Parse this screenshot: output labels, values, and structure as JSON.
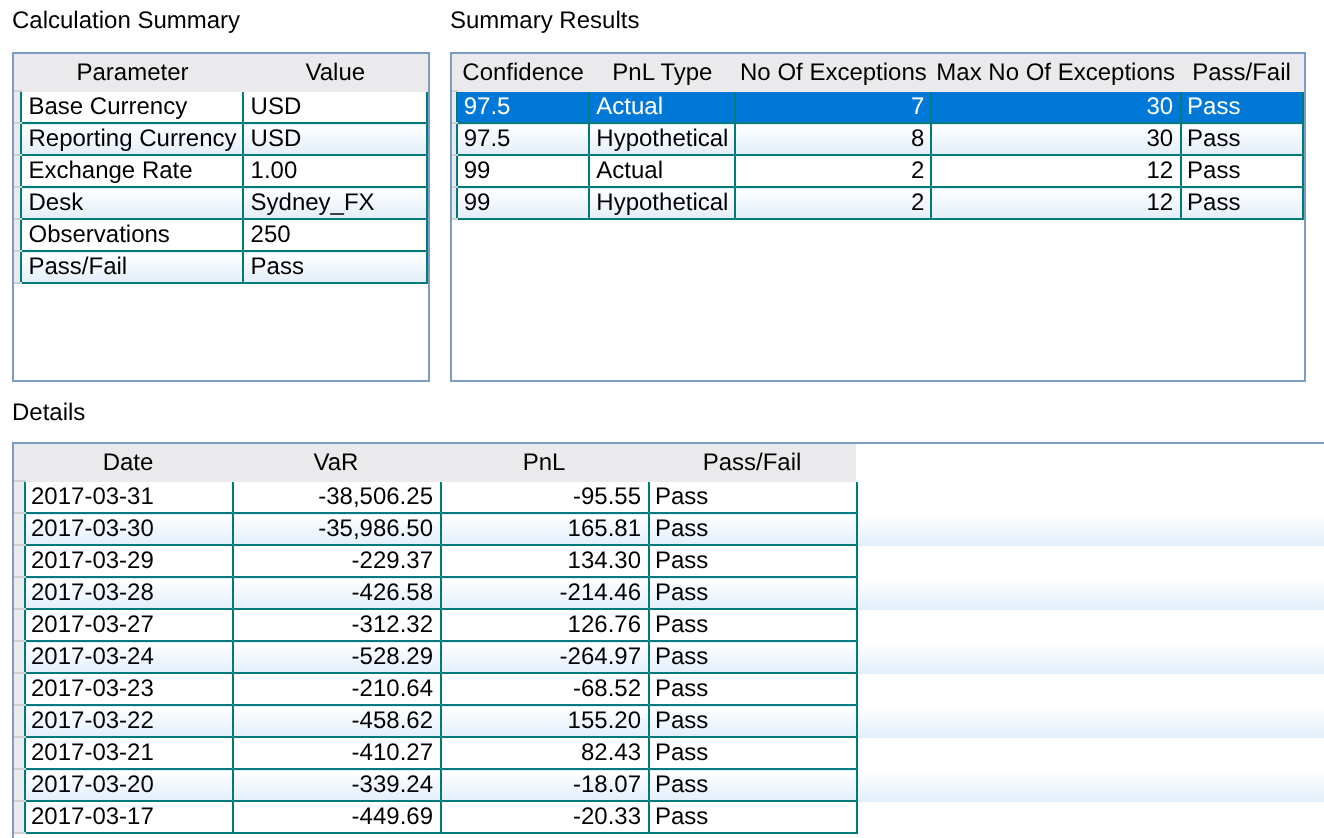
{
  "calculation_summary": {
    "title": "Calculation Summary",
    "columns": [
      "Parameter",
      "Value"
    ],
    "rows": [
      [
        "Base Currency",
        "USD"
      ],
      [
        "Reporting Currency",
        "USD"
      ],
      [
        "Exchange Rate",
        "1.00"
      ],
      [
        "Desk",
        "Sydney_FX"
      ],
      [
        "Observations",
        "250"
      ],
      [
        "Pass/Fail",
        "Pass"
      ]
    ]
  },
  "summary_results": {
    "title": "Summary Results",
    "columns": [
      "Confidence",
      "PnL Type",
      "No Of Exceptions",
      "Max No Of Exceptions",
      "Pass/Fail"
    ],
    "rows": [
      {
        "cells": [
          "97.5",
          "Actual",
          "7",
          "30",
          "Pass"
        ],
        "selected": true
      },
      {
        "cells": [
          "97.5",
          "Hypothetical",
          "8",
          "30",
          "Pass"
        ],
        "selected": false
      },
      {
        "cells": [
          "99",
          "Actual",
          "2",
          "12",
          "Pass"
        ],
        "selected": false
      },
      {
        "cells": [
          "99",
          "Hypothetical",
          "2",
          "12",
          "Pass"
        ],
        "selected": false
      }
    ]
  },
  "details": {
    "title": "Details",
    "columns": [
      "Date",
      "VaR",
      "PnL",
      "Pass/Fail"
    ],
    "rows": [
      [
        "2017-03-31",
        "-38,506.25",
        "-95.55",
        "Pass"
      ],
      [
        "2017-03-30",
        "-35,986.50",
        "165.81",
        "Pass"
      ],
      [
        "2017-03-29",
        "-229.37",
        "134.30",
        "Pass"
      ],
      [
        "2017-03-28",
        "-426.58",
        "-214.46",
        "Pass"
      ],
      [
        "2017-03-27",
        "-312.32",
        "126.76",
        "Pass"
      ],
      [
        "2017-03-24",
        "-528.29",
        "-264.97",
        "Pass"
      ],
      [
        "2017-03-23",
        "-210.64",
        "-68.52",
        "Pass"
      ],
      [
        "2017-03-22",
        "-458.62",
        "155.20",
        "Pass"
      ],
      [
        "2017-03-21",
        "-410.27",
        "82.43",
        "Pass"
      ],
      [
        "2017-03-20",
        "-339.24",
        "-18.07",
        "Pass"
      ],
      [
        "2017-03-17",
        "-449.69",
        "-20.33",
        "Pass"
      ]
    ]
  }
}
